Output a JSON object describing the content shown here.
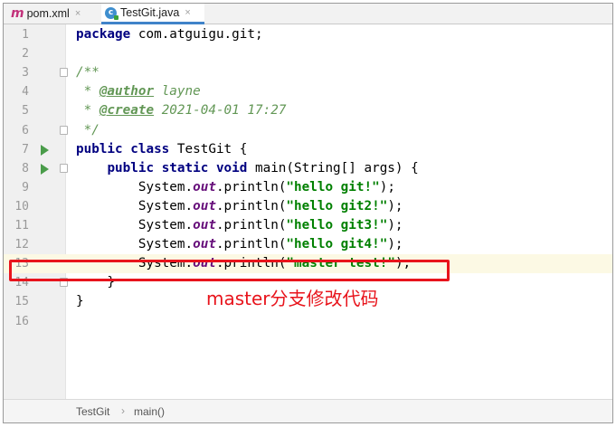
{
  "tabs": [
    {
      "label": "pom.xml",
      "icon": "maven-m-icon",
      "close": "×"
    },
    {
      "label": "TestGit.java",
      "icon": "java-class-icon",
      "close": "×",
      "active": true
    }
  ],
  "code_lines": [
    {
      "num": "1",
      "parts": [
        {
          "t": "package",
          "c": "kw"
        },
        {
          "t": " com.atguigu.git;"
        }
      ]
    },
    {
      "num": "2",
      "parts": []
    },
    {
      "num": "3",
      "fold": true,
      "parts": [
        {
          "t": "/**",
          "c": "cm"
        }
      ]
    },
    {
      "num": "4",
      "parts": [
        {
          "t": " * ",
          "c": "cm"
        },
        {
          "t": "@author",
          "c": "tag"
        },
        {
          "t": " layne",
          "c": "cm"
        }
      ]
    },
    {
      "num": "5",
      "parts": [
        {
          "t": " * ",
          "c": "cm"
        },
        {
          "t": "@create",
          "c": "tag"
        },
        {
          "t": " 2021-04-01 17:27",
          "c": "cm"
        }
      ]
    },
    {
      "num": "6",
      "fold": true,
      "parts": [
        {
          "t": " */",
          "c": "cm"
        }
      ]
    },
    {
      "num": "7",
      "run": true,
      "parts": [
        {
          "t": "public class",
          "c": "kw"
        },
        {
          "t": " TestGit {"
        }
      ]
    },
    {
      "num": "8",
      "run": true,
      "fold": true,
      "parts": [
        {
          "t": "    "
        },
        {
          "t": "public static void",
          "c": "kw"
        },
        {
          "t": " main(String[] args) {"
        }
      ]
    },
    {
      "num": "9",
      "parts": [
        {
          "t": "        System."
        },
        {
          "t": "out",
          "c": "fld"
        },
        {
          "t": ".println("
        },
        {
          "t": "\"hello git!\"",
          "c": "str"
        },
        {
          "t": ");"
        }
      ]
    },
    {
      "num": "10",
      "parts": [
        {
          "t": "        System."
        },
        {
          "t": "out",
          "c": "fld"
        },
        {
          "t": ".println("
        },
        {
          "t": "\"hello git2!\"",
          "c": "str"
        },
        {
          "t": ");"
        }
      ]
    },
    {
      "num": "11",
      "parts": [
        {
          "t": "        System."
        },
        {
          "t": "out",
          "c": "fld"
        },
        {
          "t": ".println("
        },
        {
          "t": "\"hello git3!\"",
          "c": "str"
        },
        {
          "t": ");"
        }
      ]
    },
    {
      "num": "12",
      "parts": [
        {
          "t": "        System."
        },
        {
          "t": "out",
          "c": "fld"
        },
        {
          "t": ".println("
        },
        {
          "t": "\"hello git4!\"",
          "c": "str"
        },
        {
          "t": ");"
        }
      ]
    },
    {
      "num": "13",
      "current": true,
      "parts": [
        {
          "t": "        System."
        },
        {
          "t": "out",
          "c": "fld"
        },
        {
          "t": ".println("
        },
        {
          "t": "\"master test!\"",
          "c": "str"
        },
        {
          "t": ");"
        }
      ]
    },
    {
      "num": "14",
      "fold": true,
      "parts": [
        {
          "t": "    }"
        }
      ]
    },
    {
      "num": "15",
      "parts": [
        {
          "t": "}"
        }
      ]
    },
    {
      "num": "16",
      "parts": []
    }
  ],
  "annotation": {
    "text": "master分支修改代码",
    "color": "#e8141c"
  },
  "breadcrumb": {
    "items": [
      "TestGit",
      "main()"
    ],
    "separator": "›"
  },
  "colors": {
    "keyword": "#000080",
    "string": "#008000",
    "comment": "#629755",
    "field": "#660e7a"
  }
}
